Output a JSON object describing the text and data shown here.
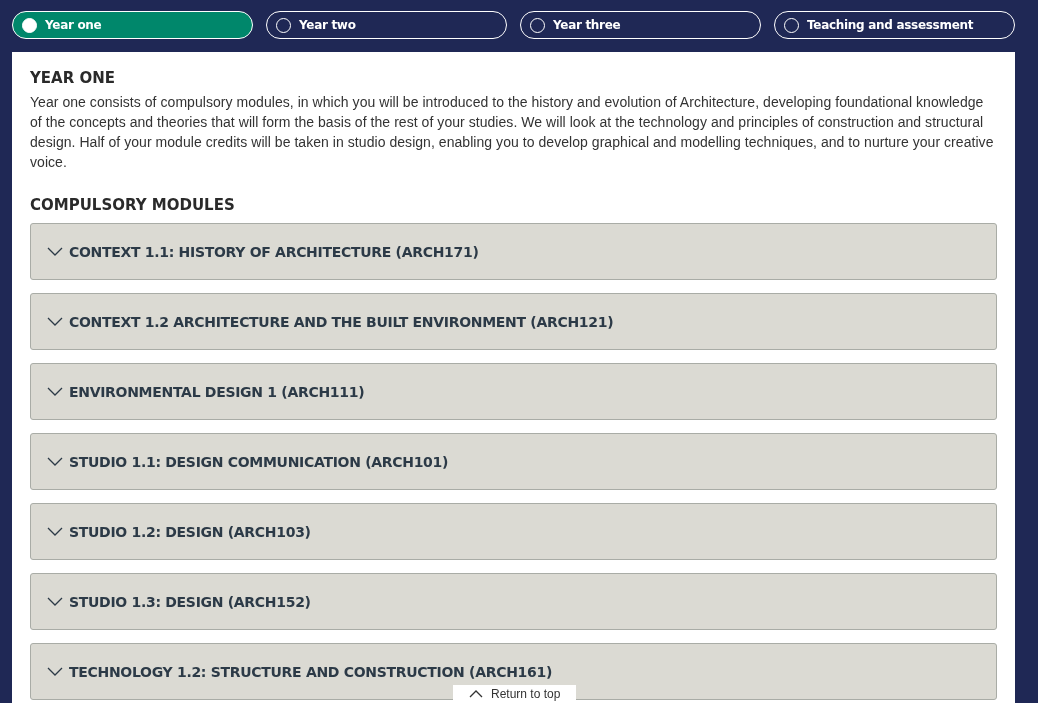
{
  "tabs": [
    {
      "label": "Year one",
      "selected": true
    },
    {
      "label": "Year two",
      "selected": false
    },
    {
      "label": "Year three",
      "selected": false
    },
    {
      "label": "Teaching and assessment",
      "selected": false
    }
  ],
  "section": {
    "title": "YEAR ONE",
    "description": "Year one consists of compulsory modules, in which you will be introduced to the history and evolution of Architecture, developing foundational knowledge of the concepts and theories that will form the basis of the rest of your studies. We will look at the technology and principles of construction and structural design. Half of your module credits will be taken in studio design, enabling you to develop graphical and modelling techniques, and to nurture your creative voice."
  },
  "modules": {
    "title": "COMPULSORY MODULES",
    "items": [
      {
        "label": "CONTEXT 1.1: HISTORY OF ARCHITECTURE (ARCH171)",
        "expanded": false
      },
      {
        "label": "CONTEXT 1.2 ARCHITECTURE AND THE BUILT ENVIRONMENT (ARCH121)",
        "expanded": false
      },
      {
        "label": "ENVIRONMENTAL DESIGN 1 (ARCH111)",
        "expanded": false
      },
      {
        "label": "STUDIO 1.1: DESIGN COMMUNICATION (ARCH101)",
        "expanded": false
      },
      {
        "label": "STUDIO 1.2: DESIGN (ARCH103)",
        "expanded": false
      },
      {
        "label": "STUDIO 1.3: DESIGN (ARCH152)",
        "expanded": false
      },
      {
        "label": "TECHNOLOGY 1.2: STRUCTURE AND CONSTRUCTION (ARCH161)",
        "expanded": false
      }
    ]
  },
  "return_to_top": "Return to top"
}
